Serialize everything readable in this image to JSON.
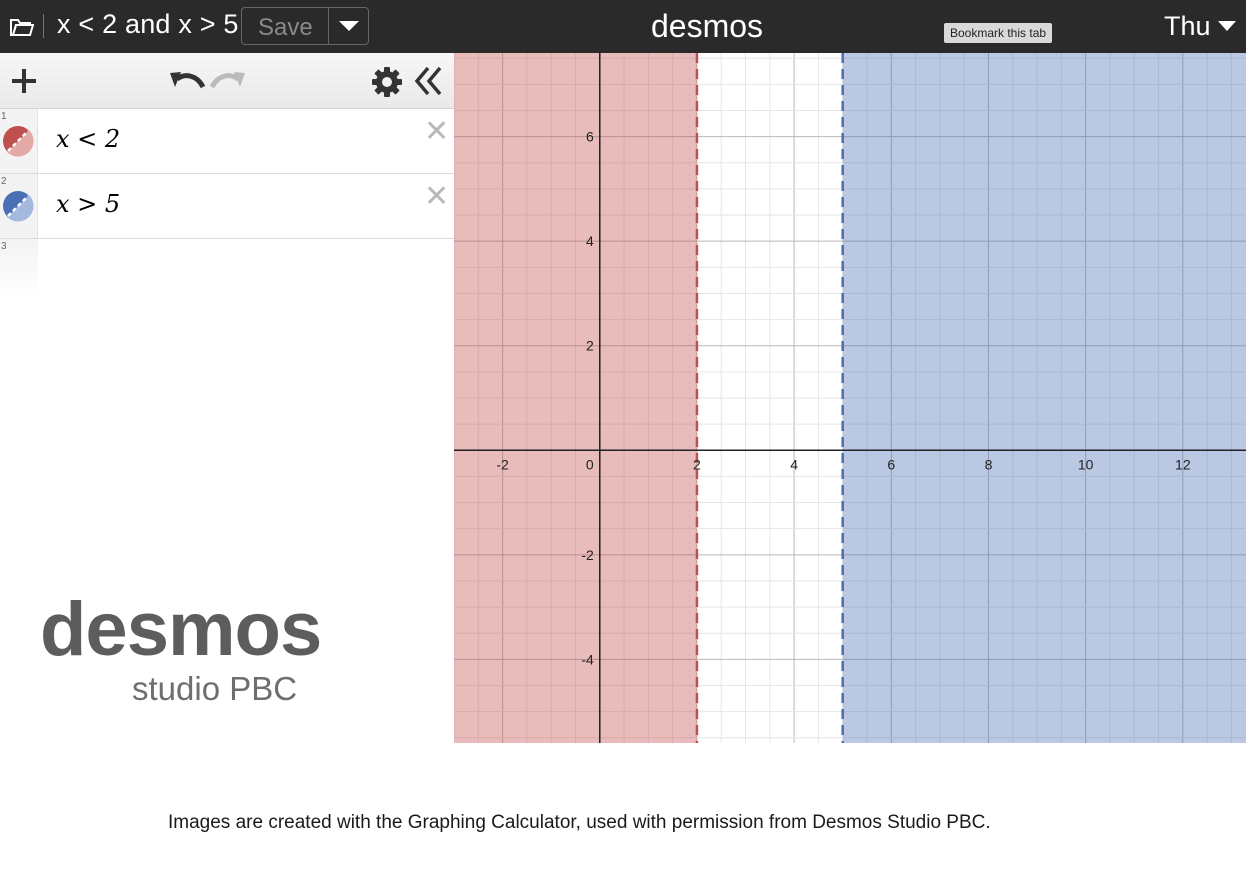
{
  "topbar": {
    "graph_title": "x < 2 and x > 5",
    "save_label": "Save",
    "brand": "desmos",
    "tooltip": "Bookmark this tab",
    "user_label": "Thu"
  },
  "expressions": [
    {
      "index": "1",
      "latex": "x < 2",
      "color": "#c0504d"
    },
    {
      "index": "2",
      "latex": "x > 5",
      "color": "#4a6fb5"
    },
    {
      "index": "3",
      "latex": "",
      "color": ""
    }
  ],
  "logo": {
    "main": "desmos",
    "sub": "studio PBC"
  },
  "caption": "Images are created with the Graphing Calculator, used with permission from Desmos Studio PBC.",
  "graph": {
    "x_tick_labels": [
      "-2",
      "0",
      "2",
      "4",
      "6",
      "8",
      "10",
      "12"
    ],
    "y_tick_labels": [
      "6",
      "4",
      "2",
      "-2",
      "-4"
    ],
    "x_range": [
      -3,
      13.3
    ],
    "y_range": [
      -5.6,
      7.6
    ],
    "regions": [
      {
        "inequality": "x < 2",
        "boundary": 2,
        "side": "left",
        "line_style": "dashed",
        "color": "#c0504d"
      },
      {
        "inequality": "x > 5",
        "boundary": 5,
        "side": "right",
        "line_style": "dashed",
        "color": "#4a6fb5"
      }
    ]
  }
}
